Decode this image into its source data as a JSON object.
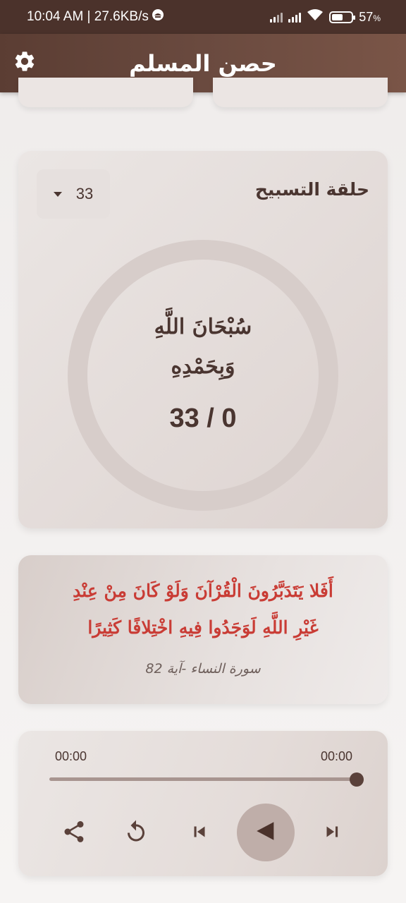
{
  "status_bar": {
    "time_speed": "10:04 AM | 27.6KB/s",
    "battery_percent": "57",
    "battery_unit": "%",
    "battery_level": 0.57
  },
  "app_bar": {
    "title": "حصن المسلم",
    "settings_icon": "gear-icon"
  },
  "tasbeeh": {
    "title": "حلقة التسبيح",
    "count_selected": "33",
    "dhikr_line1": "سُبْحَانَ اللَّهِ",
    "dhikr_line2": "وَبِحَمْدِهِ",
    "counter": "33 / 0",
    "progress": 0
  },
  "ayah": {
    "line1": "أَفَلا يَتَدَبَّرُونَ الْقُرْآنَ وَلَوْ كَانَ مِنْ عِنْدِ",
    "line2": "غَيْرِ اللَّهِ لَوَجَدُوا فِيهِ اخْتِلافًا كَثِيرًا",
    "reference": "سورة النساء -آية 82"
  },
  "player": {
    "time_start": "00:00",
    "time_end": "00:00",
    "progress": 1.0,
    "controls": [
      "share-icon",
      "repeat-icon",
      "skip-previous-icon",
      "play-icon",
      "skip-next-icon"
    ]
  },
  "colors": {
    "status_bar": "#4b322b",
    "app_bar_start": "#5b3d33",
    "app_bar_end": "#7a5547",
    "text_primary": "#4a3530",
    "ayah_text": "#c93c35",
    "ring": "#d7cdca",
    "play_button_bg": "#bfaea9"
  }
}
